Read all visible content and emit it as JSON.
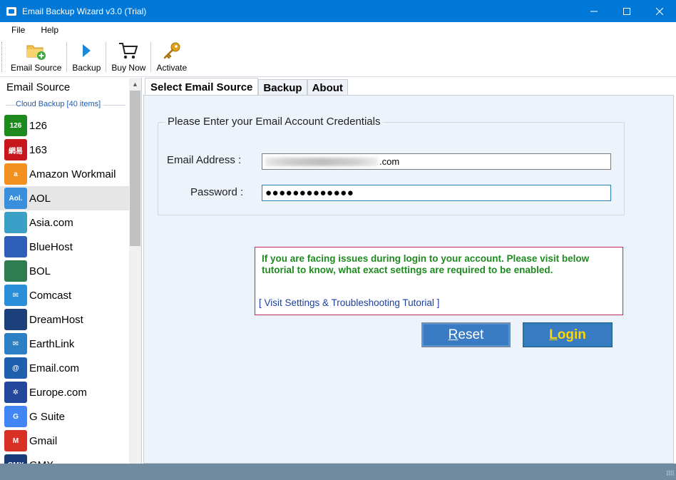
{
  "window": {
    "title": "Email Backup Wizard v3.0 (Trial)",
    "controls": [
      "minimize-icon",
      "maximize-icon",
      "close-icon"
    ]
  },
  "menu": {
    "items": [
      "File",
      "Help"
    ]
  },
  "toolbar": {
    "buttons": [
      {
        "label": "Email Source",
        "icon": "folder-add-icon"
      },
      {
        "label": "Backup",
        "icon": "play-arrow-icon"
      },
      {
        "label": "Buy Now",
        "icon": "cart-icon"
      },
      {
        "label": "Activate",
        "icon": "key-icon"
      }
    ]
  },
  "sidebar": {
    "title": "Email Source",
    "group_label": "Cloud Backup [40 items]",
    "selected": "AOL",
    "items": [
      {
        "label": "126",
        "icon": "126-logo-icon",
        "icon_text": "126",
        "color": "#1c8a1c"
      },
      {
        "label": "163",
        "icon": "163-logo-icon",
        "icon_text": "網易",
        "color": "#c8161d"
      },
      {
        "label": "Amazon Workmail",
        "icon": "amazon-logo-icon",
        "icon_text": "a",
        "color": "#f29120"
      },
      {
        "label": "AOL",
        "icon": "aol-logo-icon",
        "icon_text": "Aol.",
        "color": "#3a8fdc"
      },
      {
        "label": "Asia.com",
        "icon": "globe-icon",
        "icon_text": "",
        "color": "#3aa0c8"
      },
      {
        "label": "BlueHost",
        "icon": "grid-icon",
        "icon_text": "",
        "color": "#2f5fb8"
      },
      {
        "label": "BOL",
        "icon": "bol-logo-icon",
        "icon_text": "",
        "color": "#2f7d4f"
      },
      {
        "label": "Comcast",
        "icon": "envelope-circle-icon",
        "icon_text": "✉",
        "color": "#2a8fd8"
      },
      {
        "label": "DreamHost",
        "icon": "moon-icon",
        "icon_text": "",
        "color": "#1a3f7a"
      },
      {
        "label": "EarthLink",
        "icon": "envelope-icon",
        "icon_text": "✉",
        "color": "#2d7fc4"
      },
      {
        "label": "Email.com",
        "icon": "at-sign-icon",
        "icon_text": "@",
        "color": "#1e5fae"
      },
      {
        "label": "Europe.com",
        "icon": "eu-stars-icon",
        "icon_text": "✲",
        "color": "#23479a"
      },
      {
        "label": "G Suite",
        "icon": "google-icon",
        "icon_text": "G",
        "color": "#4285f4"
      },
      {
        "label": "Gmail",
        "icon": "gmail-icon",
        "icon_text": "M",
        "color": "#d93025"
      },
      {
        "label": "GMX",
        "icon": "gmx-logo-icon",
        "icon_text": "GMX",
        "color": "#1c3b7a"
      }
    ]
  },
  "tabs": [
    {
      "label": "Select Email Source",
      "active": true
    },
    {
      "label": "Backup",
      "active": false
    },
    {
      "label": "About",
      "active": false
    }
  ],
  "form": {
    "legend": "Please Enter your Email Account Credentials",
    "email_label": "Email Address :",
    "email_value": ".com",
    "password_label": "Password :",
    "password_value": "●●●●●●●●●●●●●"
  },
  "notice": {
    "text": "If you are facing issues during login to your account. Please visit below tutorial to know, what exact settings are required to be enabled.",
    "link": "[ Visit Settings & Troubleshooting Tutorial ]",
    "border_color": "#c0285f",
    "text_color": "#1f8a1f"
  },
  "buttons": {
    "reset": "Reset",
    "login": "Login"
  },
  "colors": {
    "titlebar": "#0078d7",
    "statusbar": "#708a9f",
    "button": "#3a7cc4",
    "login_text": "#ffd700"
  }
}
